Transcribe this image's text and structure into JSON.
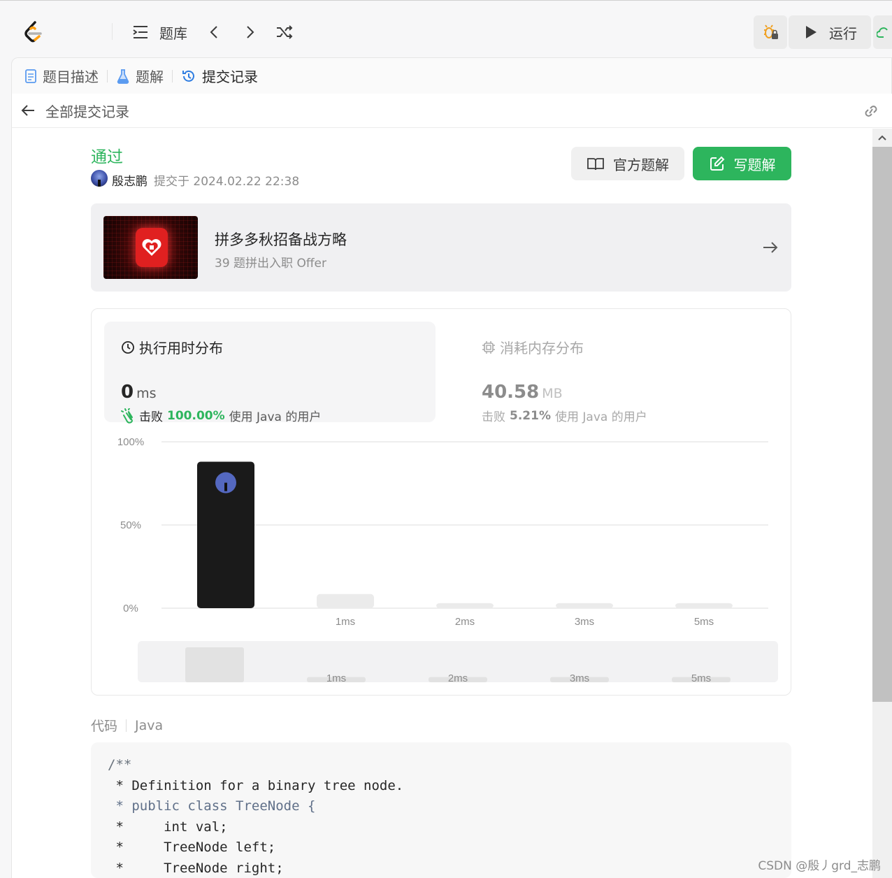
{
  "topbar": {
    "problem_list_label": "题库",
    "run_label": "运行",
    "icons": [
      "leetcode-logo",
      "list-icon",
      "chevron-left-icon",
      "chevron-right-icon",
      "shuffle-icon",
      "debug-bug-icon",
      "play-icon",
      "cloud-icon"
    ]
  },
  "tabs": [
    {
      "label": "题目描述",
      "icon": "document-icon"
    },
    {
      "label": "题解",
      "icon": "flask-icon"
    },
    {
      "label": "提交记录",
      "icon": "history-icon",
      "active": true
    }
  ],
  "back_label": "全部提交记录",
  "submission": {
    "status": "通过",
    "status_color": "#2db55d",
    "author": "殷志鹏",
    "submitted_text": "提交于 2024.02.22 22:38"
  },
  "buttons": {
    "official_solution": "官方题解",
    "write_solution": "写题解"
  },
  "promo": {
    "title": "拼多多秋招备战方略",
    "subtitle": "39 题拼出入职 Offer"
  },
  "runtime": {
    "title": "执行用时分布",
    "value": "0",
    "unit": "ms",
    "beats_prefix": "击败",
    "beats_pct": "100.00%",
    "beats_suffix": "使用 Java 的用户"
  },
  "memory": {
    "title": "消耗内存分布",
    "value": "40.58",
    "unit": "MB",
    "beats_prefix": "击败",
    "beats_pct": "5.21%",
    "beats_suffix": "使用 Java 的用户"
  },
  "chart_data": {
    "type": "bar",
    "categories": [
      "0ms",
      "1ms",
      "2ms",
      "3ms",
      "5ms"
    ],
    "tick_labels": [
      "",
      "1ms",
      "2ms",
      "3ms",
      "5ms"
    ],
    "values": [
      88,
      8.5,
      3,
      3,
      3
    ],
    "highlight_index": 0,
    "ylim": [
      0,
      100
    ],
    "y_ticks": [
      "0%",
      "50%",
      "100%"
    ],
    "grid": true,
    "overview_values": [
      20,
      3,
      3,
      3,
      3
    ],
    "overview_labels": [
      "",
      "1ms",
      "2ms",
      "3ms",
      "5ms"
    ]
  },
  "code": {
    "label": "代码",
    "language": "Java",
    "lines": [
      {
        "text": "/**",
        "style": "c1"
      },
      {
        "text": " * Definition for a binary tree node.",
        "style": ""
      },
      {
        "text": " * public class TreeNode {",
        "style": "c2"
      },
      {
        "text": " *     int val;",
        "style": ""
      },
      {
        "text": " *     TreeNode left;",
        "style": ""
      },
      {
        "text": " *     TreeNode right;",
        "style": ""
      }
    ]
  },
  "watermark": "CSDN @殷丿grd_志鹏"
}
